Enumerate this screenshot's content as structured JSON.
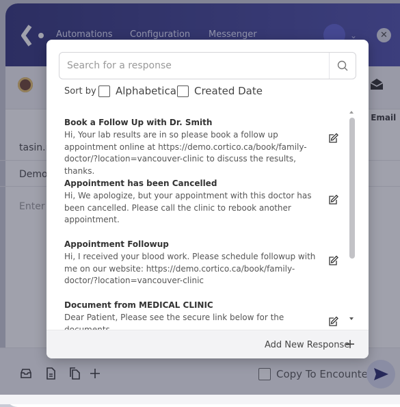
{
  "app": {
    "nav": [
      "Automations",
      "Configuration",
      "Messenger"
    ],
    "email_tab_label": "Email",
    "contact_text": "tasin.n",
    "subject_text": "Demo",
    "message_placeholder": "Enter m",
    "copy_to_encounter_label": "Copy To Encounter"
  },
  "modal": {
    "search_placeholder": "Search for a response",
    "sort_by_label": "Sort by",
    "sort_options": [
      "Alphabetical",
      "Created Date"
    ],
    "responses": [
      {
        "title": "Book a Follow Up with Dr. Smith",
        "body": "Hi, Your lab results are in so please book a follow up appointment online at https://demo.cortico.ca/book/family-doctor/?location=vancouver-clinic to discuss the results, thanks."
      },
      {
        "title": "Appointment has been Cancelled",
        "body": "Hi, We apologize, but your appointment with this doctor has been cancelled. Please call the clinic to rebook another appointment."
      },
      {
        "title": "Appointment Followup",
        "body": "Hi, I received your blood work. Please schedule followup with me on our website: https://demo.cortico.ca/book/family-doctor/?location=vancouver-clinic"
      },
      {
        "title": "Document from MEDICAL CLINIC",
        "body": "Dear Patient, Please see the secure link below for the documents"
      }
    ],
    "add_new_label": "Add New Response"
  },
  "colors": {
    "header_start": "#2d2f78",
    "header_end": "#4a4cab",
    "overlay": "rgba(45,47,70,0.45)"
  }
}
